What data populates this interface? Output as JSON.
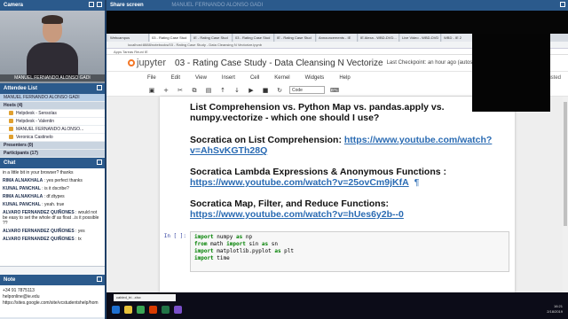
{
  "panels": {
    "camera_title": "Camera",
    "camera_name": "MANUEL FERNANDO ALONSO GADI",
    "attendee_title": "Attendee List",
    "chat_title": "Chat",
    "note_title": "Note",
    "share_title": "Share screen",
    "share_presenter": "MANUEL FERNANDO ALONSO GADI"
  },
  "attendees": [
    {
      "label": "MANUEL FERNANDO ALONSO GADI",
      "type": "sel"
    },
    {
      "label": "Hosts (4)",
      "type": "grp"
    },
    {
      "label": "Helpdesk - Sensolas",
      "type": "sub"
    },
    {
      "label": "Helpdesk - Valentin",
      "type": "sub"
    },
    {
      "label": "MANUEL FERNANDO ALONSO...",
      "type": "sub"
    },
    {
      "label": "Veronica Castinelo",
      "type": "sub"
    },
    {
      "label": "Presenters (0)",
      "type": "grp"
    },
    {
      "label": "Participants (17)",
      "type": "grp"
    }
  ],
  "chat": [
    {
      "who": "",
      "msg": "in a little bit in your browser? thanks"
    },
    {
      "who": "RIMA ALNAKHALA",
      "msg": ": yes perfect thanks"
    },
    {
      "who": "KUNAL PANCHAL",
      "msg": ": is it dscribe?"
    },
    {
      "who": "RIMA ALNAKHALA",
      "msg": ": df.dtypes"
    },
    {
      "who": "KUNAL PANCHAL",
      "msg": ": yeah. true"
    },
    {
      "who": "ALVARO FERNANDEZ QUIÑONES",
      "msg": ": would not be easy to set the whole df as float ..is it possible ??"
    },
    {
      "who": "ALVARO FERNANDEZ QUIÑONES",
      "msg": ": yes"
    },
    {
      "who": "ALVARO FERNANDEZ QUIÑONES",
      "msg": ": tx"
    }
  ],
  "note": {
    "line1": "+34 91 7875113",
    "line2": "helponline@ie.edu",
    "line3": "https://sites.google.com/site/vcstudentshelp/hom"
  },
  "browser": {
    "tabs": [
      "Webcampus",
      "03 - Rating Case Stud",
      "IE - Rating Case Stud",
      "03 - Rating Case Stud",
      "IE - Rating Case Stud",
      "Announcements - IE",
      "IE Alexa - WBD-DVD...",
      "Live Video - WBD-DVD",
      "WBD - IE 2"
    ],
    "address": "localhost:8888/notebooks/03 - Rating Case Study - Data Cleansing N Vectorize.ipynb",
    "bookmarks": "Apps   Tareas Reuni   IE"
  },
  "jupyter": {
    "logo": "jupyter",
    "title": "03 - Rating Case Study - Data Cleansing N Vectorize",
    "checkpoint": "Last Checkpoint: an hour ago (autosaved)",
    "menu": [
      "File",
      "Edit",
      "View",
      "Insert",
      "Cell",
      "Kernel",
      "Widgets",
      "Help"
    ],
    "trusted": "Trusted",
    "cell_type": "Code"
  },
  "notebook": {
    "heading": "List Comprehension vs. Python Map vs. pandas.apply vs. numpy.vectorize - which one should I use?",
    "b1_label": "Socratica on List Comprehension: ",
    "b1_link1": "https://www.youtube.com/watch?",
    "b1_link2": "v=AhSvKGTh28Q",
    "b2_label": "Socratica Lambda Expressions & Anonymous Functions :",
    "b2_link": "https://www.youtube.com/watch?v=25ovCm9jKfA",
    "pilcrow": "¶",
    "b3_label": "Socratica Map, Filter, and Reduce Functions:",
    "b3_link": "https://www.youtube.com/watch?v=hUes6y2b--0",
    "prompt": "In [ ]:",
    "code": [
      [
        "import",
        " numpy ",
        "as",
        " np"
      ],
      [
        "from",
        " math ",
        "import",
        " sin ",
        "as",
        " sn"
      ],
      [
        "import",
        " matplotlib.pyplot ",
        "as",
        " plt"
      ],
      [
        "import",
        " time",
        "",
        ""
      ]
    ]
  },
  "taskbar": {
    "download": "cabled_tri...xlsx",
    "time": "16:21",
    "date": "2/18/2019"
  },
  "colors": {
    "titlebar": "#2b5a8c",
    "link": "#2a6bb3",
    "jupyter_orange": "#f37626"
  }
}
